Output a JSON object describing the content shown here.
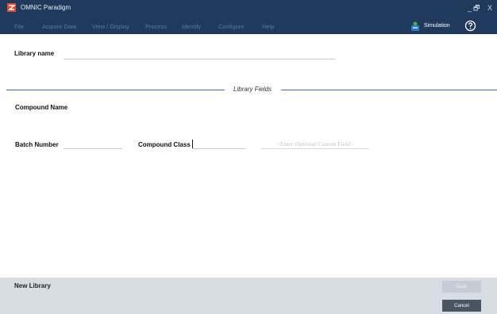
{
  "window": {
    "title": "OMNIC Paradigm",
    "controls": {
      "minimize": "_",
      "restore": "🗗",
      "close": "X"
    }
  },
  "menu": {
    "items": [
      "File",
      "Acquire Data",
      "View / Display",
      "Process",
      "Identify",
      "Configure",
      "Help"
    ]
  },
  "toolbar": {
    "simulation_label": "Simulation",
    "help_icon": "help-circle-icon"
  },
  "library": {
    "name_label": "Library name",
    "name_value": ""
  },
  "fields": {
    "section_title": "Library Fields",
    "compound_name_label": "Compound Name",
    "batch_number_label": "Batch Number",
    "batch_number_value": "",
    "compound_class_label": "Compound Class",
    "compound_class_value": "",
    "custom_field_placeholder": "<Enter Optional Custom Field>"
  },
  "footer": {
    "title": "New Library",
    "save_label": "Save",
    "cancel_label": "Cancel"
  },
  "colors": {
    "titlebar": "#1f3a5c",
    "menu_text": "#5f7897",
    "divider": "#3d6da5",
    "footer_bg": "#d8dde4",
    "cancel_bg": "#4a5563",
    "save_bg_disabled": "#c5ccd5"
  }
}
